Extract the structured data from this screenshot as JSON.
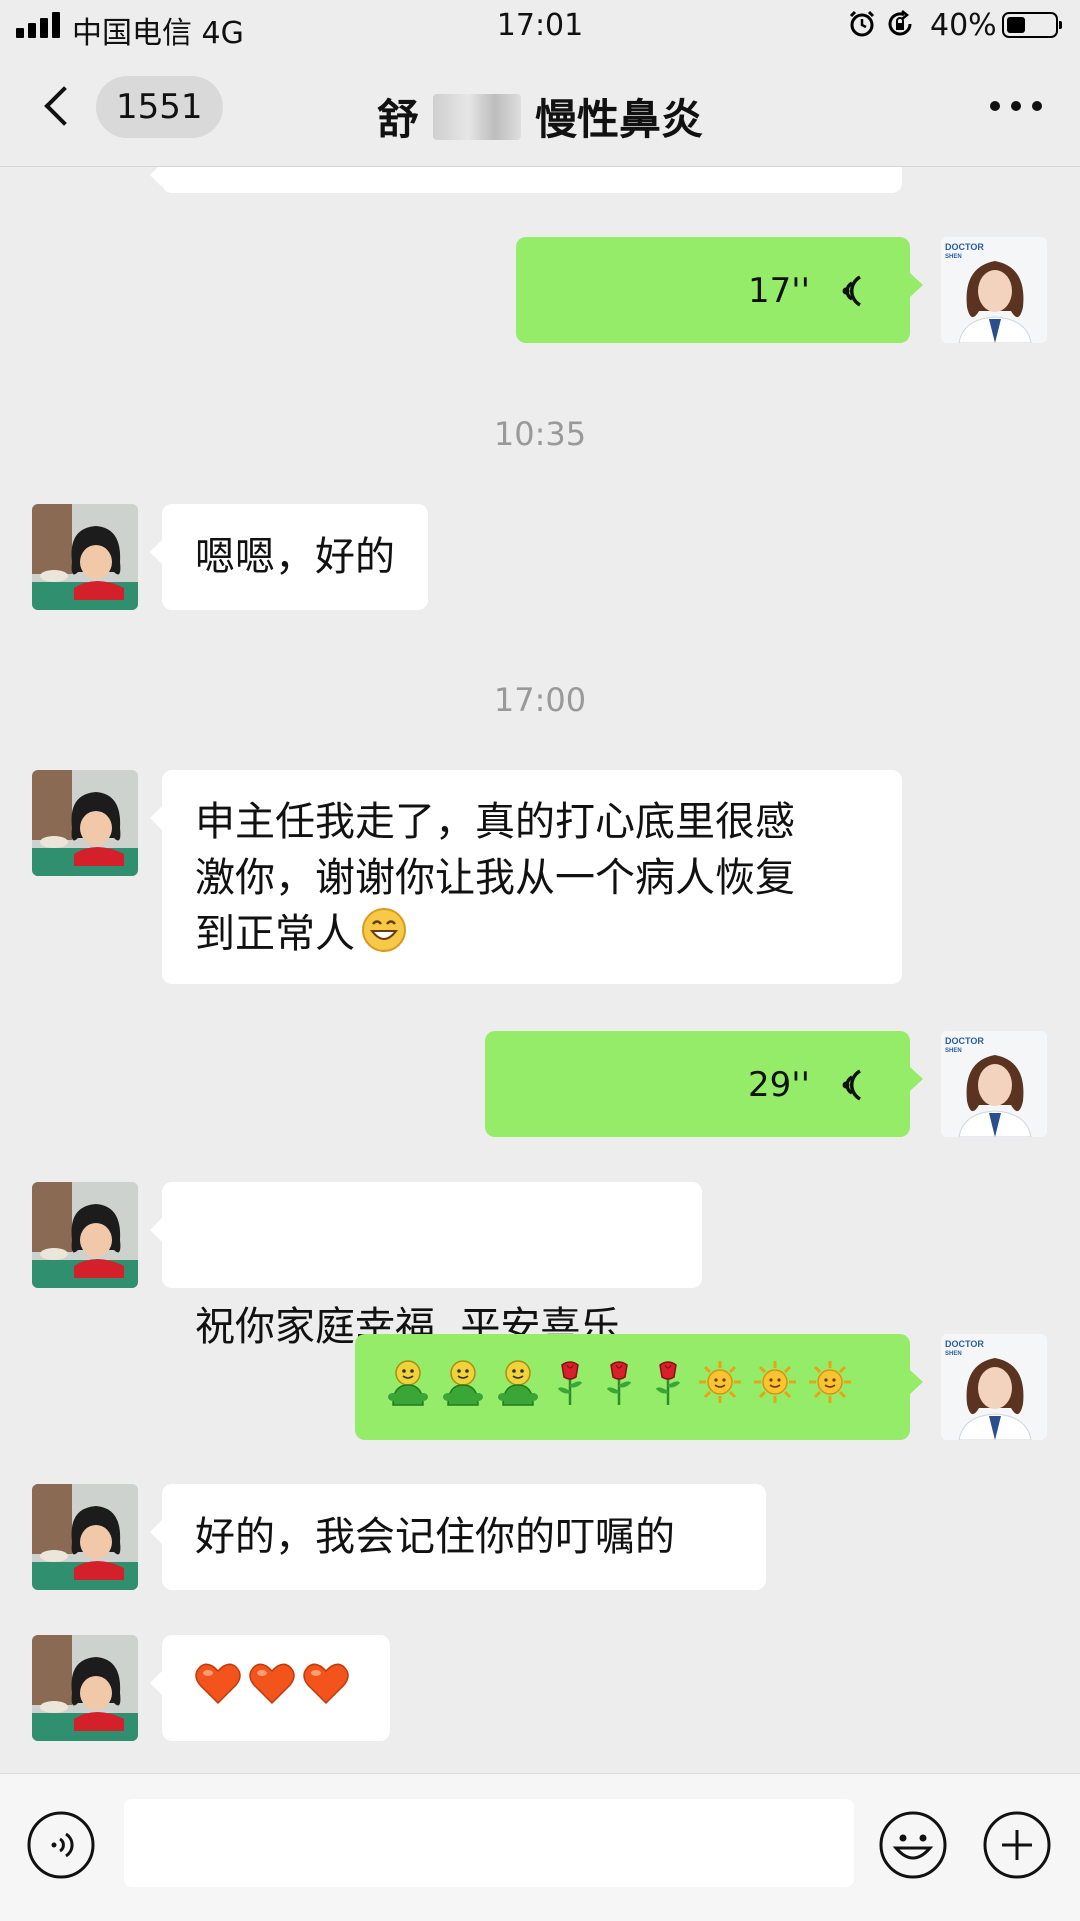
{
  "status_bar": {
    "carrier": "中国电信 4G",
    "time": "17:01",
    "battery_percent": "40%",
    "battery_level": 0.4,
    "icons": [
      "signal-icon",
      "alarm-icon",
      "orientation-lock-icon",
      "battery-icon"
    ]
  },
  "nav": {
    "back_count": "1551",
    "title_prefix": "舒",
    "title_suffix": "慢性鼻炎",
    "more_icon": "more-icon"
  },
  "messages": {
    "top_partial": {
      "sender": "other",
      "type": "text",
      "text": ""
    },
    "voice_1": {
      "sender": "me",
      "type": "voice",
      "duration": "17''"
    },
    "time_1": "10:35",
    "text_1": {
      "sender": "other",
      "type": "text",
      "text": "嗯嗯，好的"
    },
    "time_2": "17:00",
    "text_2": {
      "sender": "other",
      "type": "text",
      "lines": [
        "申主任我走了，真的打心底里很感",
        "激你，谢谢你让我从一个病人恢复",
        "到正常人"
      ],
      "trailing_emoji": "grin-emoji"
    },
    "voice_2": {
      "sender": "me",
      "type": "voice",
      "duration": "29''"
    },
    "text_3": {
      "sender": "other",
      "type": "text",
      "text": "祝你家庭幸福  平安喜乐"
    },
    "emoji_msg": {
      "sender": "me",
      "type": "emoji",
      "emojis": [
        "green-figure-emoji",
        "green-figure-emoji",
        "green-figure-emoji",
        "rose-emoji",
        "rose-emoji",
        "rose-emoji",
        "sun-emoji",
        "sun-emoji",
        "sun-emoji"
      ]
    },
    "text_4": {
      "sender": "other",
      "type": "text",
      "text": "好的，我会记住你的叮嘱的"
    },
    "hearts_msg": {
      "sender": "other",
      "type": "emoji",
      "emojis": [
        "heart-emoji",
        "heart-emoji",
        "heart-emoji"
      ]
    }
  },
  "avatars": {
    "doctor_badge_line1": "DOCTOR",
    "doctor_badge_line2": "SHEN"
  },
  "input_bar": {
    "placeholder": "",
    "icons": [
      "voice-toggle-icon",
      "emoji-icon",
      "plus-icon"
    ]
  },
  "colors": {
    "background": "#ededed",
    "bubble_out": "#95ec69",
    "bubble_in": "#ffffff",
    "timestamp_text": "#999999"
  }
}
